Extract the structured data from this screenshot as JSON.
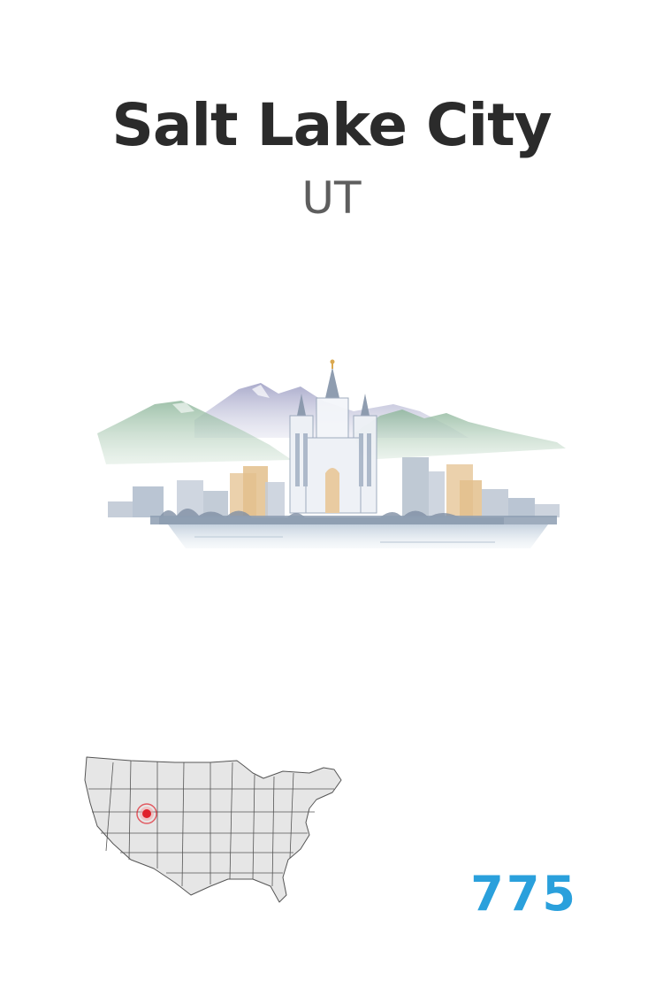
{
  "header": {
    "city": "Salt Lake City",
    "state": "UT"
  },
  "illustration": {
    "icon": "salt-lake-temple-skyline-watercolor"
  },
  "map": {
    "icon": "us-states-map-icon",
    "marker_color": "#e0202a"
  },
  "area_code": {
    "value": "775",
    "color": "#2aa0dc"
  }
}
